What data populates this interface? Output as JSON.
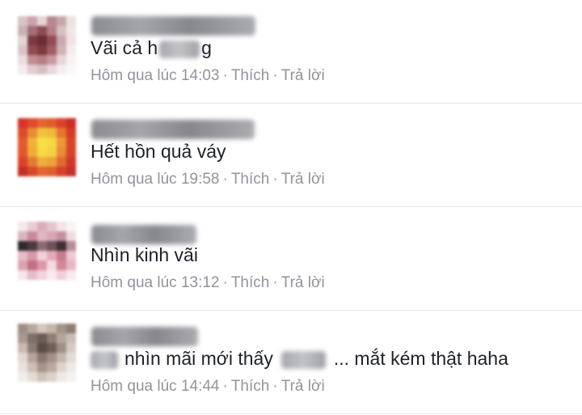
{
  "comments": [
    {
      "text_pre": "Vãi cả h",
      "text_post": "g",
      "time": "Hôm qua lúc 14:03",
      "like": "Thích",
      "reply": "Trả lời",
      "dot": "·",
      "avatar_colors": [
        "#d8c4c6",
        "#c9a3ad",
        "#e7d5d6",
        "#b88891",
        "#caa7ab",
        "#efe1e1",
        "#c9b2b4",
        "#a46f78",
        "#8e4d55",
        "#b58186",
        "#d7c0c2",
        "#f1e6e6",
        "#e4d3d5",
        "#7c3b40",
        "#6a2d33",
        "#954c55",
        "#c9a9ad",
        "#efe3e4",
        "#d9c5c7",
        "#934a52",
        "#7e3a3e",
        "#a45d62",
        "#d1b3b5",
        "#f5eded",
        "#eadedf",
        "#c08e93",
        "#b97e84",
        "#c79aa0",
        "#e7d6d8",
        "#f8f2f2",
        "#f4eced",
        "#e1cdcf",
        "#d7bfc2",
        "#e7d8da",
        "#f6efef",
        "#fbf8f8"
      ]
    },
    {
      "text_pre": "Hết hồn quả váy",
      "text_post": "",
      "time": "Hôm qua lúc 19:58",
      "like": "Thích",
      "reply": "Trả lời",
      "dot": "·",
      "avatar_colors": [
        "#d7342a",
        "#e14a2c",
        "#e46533",
        "#e25b2f",
        "#d9422b",
        "#c92d25",
        "#de4a2b",
        "#ea8b35",
        "#f2c23c",
        "#f1b83a",
        "#e67430",
        "#d23d27",
        "#e35a2f",
        "#f0b23a",
        "#f7e046",
        "#f6d843",
        "#ec973a",
        "#d7452a",
        "#e2552d",
        "#efac39",
        "#f6d945",
        "#f5d242",
        "#ea8b36",
        "#d6432a",
        "#d9432a",
        "#e47a33",
        "#eeb03b",
        "#eda43a",
        "#e26a31",
        "#ce3828",
        "#c62d25",
        "#d64a2b",
        "#e26631",
        "#df5e2f",
        "#d44229",
        "#c3302a"
      ]
    },
    {
      "text_pre": "Nhìn kinh vãi",
      "text_post": "",
      "time": "Hôm qua lúc 13:12",
      "like": "Thích",
      "reply": "Trả lời",
      "dot": "·",
      "avatar_colors": [
        "#f3e8ea",
        "#e9cdd4",
        "#d9aeb9",
        "#e7c6cf",
        "#f4e3e7",
        "#faf3f4",
        "#dcb4be",
        "#c78a9a",
        "#e0b7c1",
        "#d6a6b2",
        "#c7909e",
        "#eedbe0",
        "#2f2a2c",
        "#4b3a3f",
        "#8a6b72",
        "#6f5359",
        "#3d3033",
        "#b78c97",
        "#e7bcc7",
        "#d69aaa",
        "#f1d1d9",
        "#e3aab8",
        "#c97c8f",
        "#ecc8d1",
        "#d9a4b1",
        "#c16f83",
        "#dc98a9",
        "#f4dbe2",
        "#d38799",
        "#e9b7c3",
        "#f6e4e8",
        "#e6bcc6",
        "#f2d3db",
        "#fae9ed",
        "#efd0d8",
        "#f8eaee"
      ]
    },
    {
      "text_pre": "nhìn mãi mới thấy",
      "text_post": "... mắt kém thật haha",
      "time": "Hôm qua lúc 14:44",
      "like": "Thích",
      "reply": "Trả lời",
      "dot": "·",
      "avatar_colors": [
        "#9c8e86",
        "#b8a89c",
        "#d3c7be",
        "#c2b4aa",
        "#a39388",
        "#8c7d74",
        "#a99a90",
        "#7f7068",
        "#6b5c55",
        "#8e7f77",
        "#b5a69c",
        "#c9bdb4",
        "#c9bab0",
        "#8d7c73",
        "#5b4c47",
        "#6e5f58",
        "#a08f86",
        "#d5cbc4",
        "#e2d8d1",
        "#b6a49a",
        "#8a776e",
        "#a39187",
        "#c5b7ae",
        "#e3dad4",
        "#eae2dd",
        "#cdbfb6",
        "#a89488",
        "#bba99e",
        "#ded3cc",
        "#efe9e5",
        "#f2ede9",
        "#e4dbd5",
        "#cfc2ba",
        "#ddd2cb",
        "#eee8e4",
        "#f6f2ef"
      ]
    }
  ]
}
